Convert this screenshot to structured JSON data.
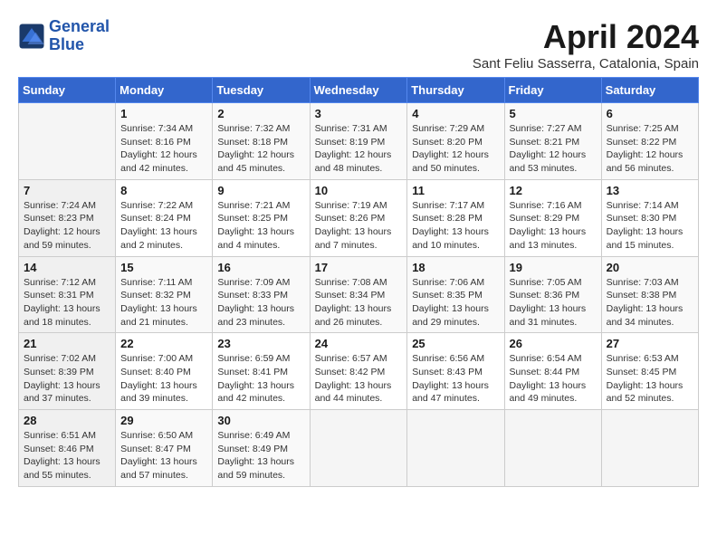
{
  "logo": {
    "text_general": "General",
    "text_blue": "Blue"
  },
  "header": {
    "title": "April 2024",
    "subtitle": "Sant Feliu Sasserra, Catalonia, Spain"
  },
  "weekdays": [
    "Sunday",
    "Monday",
    "Tuesday",
    "Wednesday",
    "Thursday",
    "Friday",
    "Saturday"
  ],
  "weeks": [
    [
      {
        "day": "",
        "info": ""
      },
      {
        "day": "1",
        "info": "Sunrise: 7:34 AM\nSunset: 8:16 PM\nDaylight: 12 hours\nand 42 minutes."
      },
      {
        "day": "2",
        "info": "Sunrise: 7:32 AM\nSunset: 8:18 PM\nDaylight: 12 hours\nand 45 minutes."
      },
      {
        "day": "3",
        "info": "Sunrise: 7:31 AM\nSunset: 8:19 PM\nDaylight: 12 hours\nand 48 minutes."
      },
      {
        "day": "4",
        "info": "Sunrise: 7:29 AM\nSunset: 8:20 PM\nDaylight: 12 hours\nand 50 minutes."
      },
      {
        "day": "5",
        "info": "Sunrise: 7:27 AM\nSunset: 8:21 PM\nDaylight: 12 hours\nand 53 minutes."
      },
      {
        "day": "6",
        "info": "Sunrise: 7:25 AM\nSunset: 8:22 PM\nDaylight: 12 hours\nand 56 minutes."
      }
    ],
    [
      {
        "day": "7",
        "info": "Sunrise: 7:24 AM\nSunset: 8:23 PM\nDaylight: 12 hours\nand 59 minutes."
      },
      {
        "day": "8",
        "info": "Sunrise: 7:22 AM\nSunset: 8:24 PM\nDaylight: 13 hours\nand 2 minutes."
      },
      {
        "day": "9",
        "info": "Sunrise: 7:21 AM\nSunset: 8:25 PM\nDaylight: 13 hours\nand 4 minutes."
      },
      {
        "day": "10",
        "info": "Sunrise: 7:19 AM\nSunset: 8:26 PM\nDaylight: 13 hours\nand 7 minutes."
      },
      {
        "day": "11",
        "info": "Sunrise: 7:17 AM\nSunset: 8:28 PM\nDaylight: 13 hours\nand 10 minutes."
      },
      {
        "day": "12",
        "info": "Sunrise: 7:16 AM\nSunset: 8:29 PM\nDaylight: 13 hours\nand 13 minutes."
      },
      {
        "day": "13",
        "info": "Sunrise: 7:14 AM\nSunset: 8:30 PM\nDaylight: 13 hours\nand 15 minutes."
      }
    ],
    [
      {
        "day": "14",
        "info": "Sunrise: 7:12 AM\nSunset: 8:31 PM\nDaylight: 13 hours\nand 18 minutes."
      },
      {
        "day": "15",
        "info": "Sunrise: 7:11 AM\nSunset: 8:32 PM\nDaylight: 13 hours\nand 21 minutes."
      },
      {
        "day": "16",
        "info": "Sunrise: 7:09 AM\nSunset: 8:33 PM\nDaylight: 13 hours\nand 23 minutes."
      },
      {
        "day": "17",
        "info": "Sunrise: 7:08 AM\nSunset: 8:34 PM\nDaylight: 13 hours\nand 26 minutes."
      },
      {
        "day": "18",
        "info": "Sunrise: 7:06 AM\nSunset: 8:35 PM\nDaylight: 13 hours\nand 29 minutes."
      },
      {
        "day": "19",
        "info": "Sunrise: 7:05 AM\nSunset: 8:36 PM\nDaylight: 13 hours\nand 31 minutes."
      },
      {
        "day": "20",
        "info": "Sunrise: 7:03 AM\nSunset: 8:38 PM\nDaylight: 13 hours\nand 34 minutes."
      }
    ],
    [
      {
        "day": "21",
        "info": "Sunrise: 7:02 AM\nSunset: 8:39 PM\nDaylight: 13 hours\nand 37 minutes."
      },
      {
        "day": "22",
        "info": "Sunrise: 7:00 AM\nSunset: 8:40 PM\nDaylight: 13 hours\nand 39 minutes."
      },
      {
        "day": "23",
        "info": "Sunrise: 6:59 AM\nSunset: 8:41 PM\nDaylight: 13 hours\nand 42 minutes."
      },
      {
        "day": "24",
        "info": "Sunrise: 6:57 AM\nSunset: 8:42 PM\nDaylight: 13 hours\nand 44 minutes."
      },
      {
        "day": "25",
        "info": "Sunrise: 6:56 AM\nSunset: 8:43 PM\nDaylight: 13 hours\nand 47 minutes."
      },
      {
        "day": "26",
        "info": "Sunrise: 6:54 AM\nSunset: 8:44 PM\nDaylight: 13 hours\nand 49 minutes."
      },
      {
        "day": "27",
        "info": "Sunrise: 6:53 AM\nSunset: 8:45 PM\nDaylight: 13 hours\nand 52 minutes."
      }
    ],
    [
      {
        "day": "28",
        "info": "Sunrise: 6:51 AM\nSunset: 8:46 PM\nDaylight: 13 hours\nand 55 minutes."
      },
      {
        "day": "29",
        "info": "Sunrise: 6:50 AM\nSunset: 8:47 PM\nDaylight: 13 hours\nand 57 minutes."
      },
      {
        "day": "30",
        "info": "Sunrise: 6:49 AM\nSunset: 8:49 PM\nDaylight: 13 hours\nand 59 minutes."
      },
      {
        "day": "",
        "info": ""
      },
      {
        "day": "",
        "info": ""
      },
      {
        "day": "",
        "info": ""
      },
      {
        "day": "",
        "info": ""
      }
    ]
  ]
}
